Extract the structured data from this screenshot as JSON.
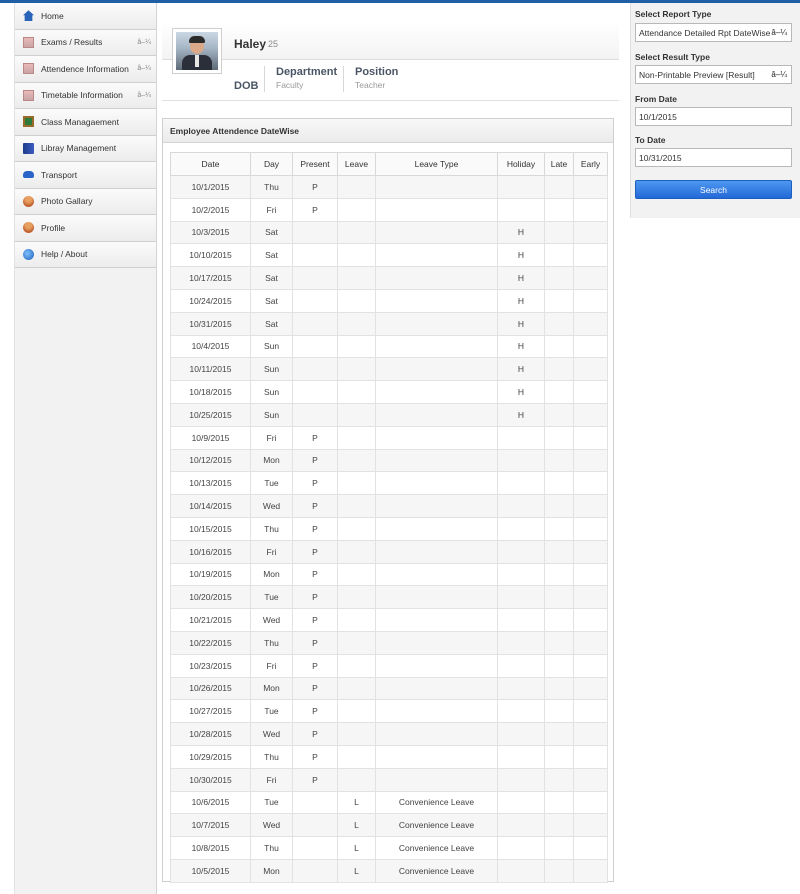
{
  "sidebar": {
    "items": [
      {
        "label": "Home",
        "icon": "home-icon",
        "arrow": ""
      },
      {
        "label": "Exams / Results",
        "icon": "exam-icon",
        "arrow": "â–¼"
      },
      {
        "label": "Attendence Information",
        "icon": "attendance-icon",
        "arrow": "â–¼"
      },
      {
        "label": "Timetable Information",
        "icon": "timetable-icon",
        "arrow": "â–¼"
      },
      {
        "label": "Class Managaement",
        "icon": "class-icon",
        "arrow": ""
      },
      {
        "label": "Libray Management",
        "icon": "library-icon",
        "arrow": ""
      },
      {
        "label": "Transport",
        "icon": "bus-icon",
        "arrow": ""
      },
      {
        "label": "Photo Gallary",
        "icon": "photo-icon",
        "arrow": ""
      },
      {
        "label": "Profile",
        "icon": "profile-icon",
        "arrow": ""
      },
      {
        "label": "Help / About",
        "icon": "globe-icon",
        "arrow": ""
      }
    ]
  },
  "profile": {
    "name": "Haley",
    "age": "25",
    "dob_label": "DOB",
    "dob_value": "",
    "department_label": "Department",
    "department_value": "Faculty",
    "position_label": "Position",
    "position_value": "Teacher"
  },
  "panel": {
    "title": "Employee Attendence DateWise",
    "columns": [
      "Date",
      "Day",
      "Present",
      "Leave",
      "Leave Type",
      "Holiday",
      "Late",
      "Early"
    ],
    "rows": [
      [
        "10/1/2015",
        "Thu",
        "P",
        "",
        "",
        "",
        "",
        ""
      ],
      [
        "10/2/2015",
        "Fri",
        "P",
        "",
        "",
        "",
        "",
        ""
      ],
      [
        "10/3/2015",
        "Sat",
        "",
        "",
        "",
        "H",
        "",
        ""
      ],
      [
        "10/10/2015",
        "Sat",
        "",
        "",
        "",
        "H",
        "",
        ""
      ],
      [
        "10/17/2015",
        "Sat",
        "",
        "",
        "",
        "H",
        "",
        ""
      ],
      [
        "10/24/2015",
        "Sat",
        "",
        "",
        "",
        "H",
        "",
        ""
      ],
      [
        "10/31/2015",
        "Sat",
        "",
        "",
        "",
        "H",
        "",
        ""
      ],
      [
        "10/4/2015",
        "Sun",
        "",
        "",
        "",
        "H",
        "",
        ""
      ],
      [
        "10/11/2015",
        "Sun",
        "",
        "",
        "",
        "H",
        "",
        ""
      ],
      [
        "10/18/2015",
        "Sun",
        "",
        "",
        "",
        "H",
        "",
        ""
      ],
      [
        "10/25/2015",
        "Sun",
        "",
        "",
        "",
        "H",
        "",
        ""
      ],
      [
        "10/9/2015",
        "Fri",
        "P",
        "",
        "",
        "",
        "",
        ""
      ],
      [
        "10/12/2015",
        "Mon",
        "P",
        "",
        "",
        "",
        "",
        ""
      ],
      [
        "10/13/2015",
        "Tue",
        "P",
        "",
        "",
        "",
        "",
        ""
      ],
      [
        "10/14/2015",
        "Wed",
        "P",
        "",
        "",
        "",
        "",
        ""
      ],
      [
        "10/15/2015",
        "Thu",
        "P",
        "",
        "",
        "",
        "",
        ""
      ],
      [
        "10/16/2015",
        "Fri",
        "P",
        "",
        "",
        "",
        "",
        ""
      ],
      [
        "10/19/2015",
        "Mon",
        "P",
        "",
        "",
        "",
        "",
        ""
      ],
      [
        "10/20/2015",
        "Tue",
        "P",
        "",
        "",
        "",
        "",
        ""
      ],
      [
        "10/21/2015",
        "Wed",
        "P",
        "",
        "",
        "",
        "",
        ""
      ],
      [
        "10/22/2015",
        "Thu",
        "P",
        "",
        "",
        "",
        "",
        ""
      ],
      [
        "10/23/2015",
        "Fri",
        "P",
        "",
        "",
        "",
        "",
        ""
      ],
      [
        "10/26/2015",
        "Mon",
        "P",
        "",
        "",
        "",
        "",
        ""
      ],
      [
        "10/27/2015",
        "Tue",
        "P",
        "",
        "",
        "",
        "",
        ""
      ],
      [
        "10/28/2015",
        "Wed",
        "P",
        "",
        "",
        "",
        "",
        ""
      ],
      [
        "10/29/2015",
        "Thu",
        "P",
        "",
        "",
        "",
        "",
        ""
      ],
      [
        "10/30/2015",
        "Fri",
        "P",
        "",
        "",
        "",
        "",
        ""
      ],
      [
        "10/6/2015",
        "Tue",
        "",
        "L",
        "Convenience Leave",
        "",
        "",
        ""
      ],
      [
        "10/7/2015",
        "Wed",
        "",
        "L",
        "Convenience Leave",
        "",
        "",
        ""
      ],
      [
        "10/8/2015",
        "Thu",
        "",
        "L",
        "Convenience Leave",
        "",
        "",
        ""
      ],
      [
        "10/5/2015",
        "Mon",
        "",
        "L",
        "Convenience Leave",
        "",
        "",
        ""
      ]
    ]
  },
  "filters": {
    "report_type_label": "Select Report Type",
    "report_type_value": "Attendance Detailed Rpt DateWise",
    "result_type_label": "Select Result Type",
    "result_type_value": "Non-Printable Preview [Result]",
    "from_date_label": "From Date",
    "from_date_value": "10/1/2015",
    "to_date_label": "To Date",
    "to_date_value": "10/31/2015",
    "search_label": "Search",
    "caret": "â–¼"
  },
  "colors": {
    "accent": "#2a6fd8",
    "topbar": "#1f5fa8"
  }
}
